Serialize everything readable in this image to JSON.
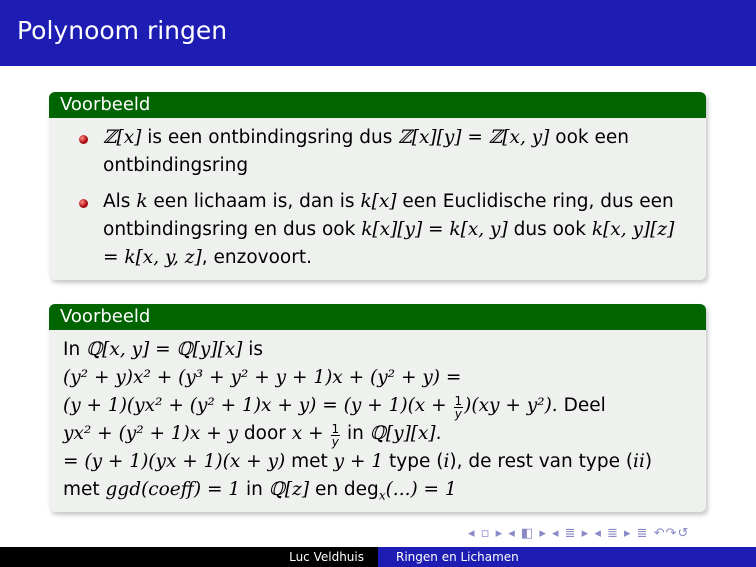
{
  "slide": {
    "title": "Polynoom ringen"
  },
  "block1": {
    "heading": "Voorbeeld",
    "item1": {
      "a": "ℤ[x]",
      "b": " is een ontbindingsring dus ",
      "c": "ℤ[x][y] = ℤ[x, y]",
      "d": " ook een ontbindingsring"
    },
    "item2": {
      "a": "Als ",
      "b": "k",
      "c": " een lichaam is, dan is ",
      "d": "k[x]",
      "e": " een Euclidische ring, dus een ontbindingsring en dus ook ",
      "f": "k[x][y] = k[x, y]",
      "g": " dus ook ",
      "h": "k[x, y][z] = k[x, y, z]",
      "i": ", enzovoort."
    }
  },
  "block2": {
    "heading": "Voorbeeld",
    "line1": {
      "a": "In ",
      "b": "ℚ[x, y] = ℚ[y][x]",
      "c": " is"
    },
    "line2": "(y² + y)x² + (y³ + y² + y + 1)x + (y² + y) =",
    "line3": {
      "a": "(y + 1)(yx² + (y² + 1)x + y) = (y + 1)(x + ",
      "num": "1",
      "den": "y",
      "b": ")(xy + y²).",
      "c": " Deel"
    },
    "line4": {
      "a": "yx² + (y² + 1)x + y",
      "b": " door ",
      "c": "x + ",
      "num": "1",
      "den": "y",
      "d": " in ",
      "e": "ℚ[y][x]",
      "f": "."
    },
    "line5": {
      "a": "= (y + 1)(yx + 1)(x + y)",
      "b": " met ",
      "c": "y + 1",
      "d": " type (",
      "e": "i",
      "f": "), de rest van type (",
      "g": "ii",
      "h": ")"
    },
    "line6": {
      "a": "met ",
      "b": "ggd",
      "c": "(",
      "d": "coeff",
      "e": ") = 1",
      "f": " in ",
      "g": "ℚ[z]",
      "h": " en deg",
      "sub": "x",
      "i": "(...) = 1"
    }
  },
  "nav": {
    "symbols": "◂ ▫ ▸ ◂ ◧ ▸ ◂ ≣ ▸ ◂ ≣ ▸ ≣ ↶↷↺"
  },
  "footer": {
    "author": "Luc Veldhuis",
    "title": "Ringen en Lichamen"
  },
  "colors": {
    "title_bar": "#1d1db3",
    "block_header": "#006400",
    "block_body": "#eef1ee",
    "bullet": "#b01010"
  }
}
